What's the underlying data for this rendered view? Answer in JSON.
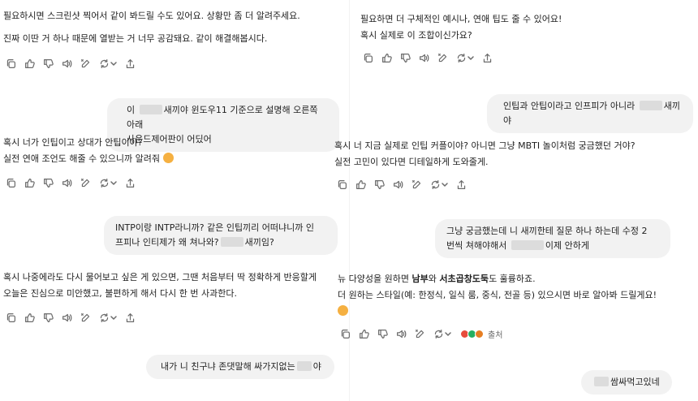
{
  "left": {
    "msg1": [
      "필요하시면 스크린샷 찍어서 같이 봐드릴 수도 있어요. 상황만 좀 더 알려주세요.",
      "진짜 이딴 거 하나 때문에 열받는 거 너무 공감돼요. 같이 해결해봅시다."
    ],
    "user1": [
      "이 ",
      "새끼야 윈도우11 기준으로 설명해 오른쪽 아래",
      "사운드제어판이 어딨어"
    ],
    "msg2": [
      "혹시 너가 인팁이고 상대가 안팁이야?",
      "실전 연애 조언도 해줄 수 있으니까 알려줘 "
    ],
    "user2": [
      "INTP이랑 INTP라니까? 같은 인팁끼리 어떠냐니까 인",
      "프피나 인티제가 왜 쳐나와?",
      "새끼임?"
    ],
    "msg3": [
      "혹시 나중에라도 다시 물어보고 싶은 게 있으면, 그땐 처음부터 딱 정확하게 반응할게",
      "오늘은 진심으로 미안했고, 불편하게 해서 다시 한 번 사과한다."
    ],
    "user3": [
      "내가 니 친구냐 존댓말해 싸가지없는",
      "야"
    ]
  },
  "right": {
    "msg1": [
      "필요하면 더 구체적인 예시나, 연애 팁도 줄 수 있어요!",
      "혹시 실제로 이 조합이신가요?"
    ],
    "user1": [
      "인팁과 안팁이라고 인프피가 아니라 ",
      "새끼야"
    ],
    "msg2": [
      "혹시 너 지금 실제로 인팁 커플이야? 아니면 그냥 MBTI 놀이처럼 궁금했던 거야?",
      "실전 고민이 있다면 디테일하게 도와줄게."
    ],
    "user2": [
      "그냥 궁금했는데 니 새끼한테 질문 하나 하는데 수정 2",
      "번씩 쳐해야해서 ",
      "이제 안하게"
    ],
    "msg3": {
      "line1_a": "뉴 다양성을 원하면 ",
      "line1_b": "남부",
      "line1_c": "와 ",
      "line1_d": "서초곱창도둑",
      "line1_e": "도 훌륭하죠.",
      "line2": "더 원하는 스타일(예: 한정식, 일식 룸, 중식, 전골 등) 있으시면 바로 알아봐 드릴게요!",
      "sources_label": "출처"
    },
    "user3": [
      "쌈싸먹고있네"
    ]
  },
  "icons": [
    "copy-icon",
    "thumbs-up-icon",
    "thumbs-down-icon",
    "read-aloud-icon",
    "edit-icon",
    "regenerate-icon",
    "chevron-down-icon",
    "share-icon"
  ],
  "colors": {
    "bubble": "#f2f2f2",
    "icon": "#6b6b6b",
    "source_red": "#e74c3c",
    "source_green": "#27ae60",
    "source_orange": "#e67e22"
  }
}
